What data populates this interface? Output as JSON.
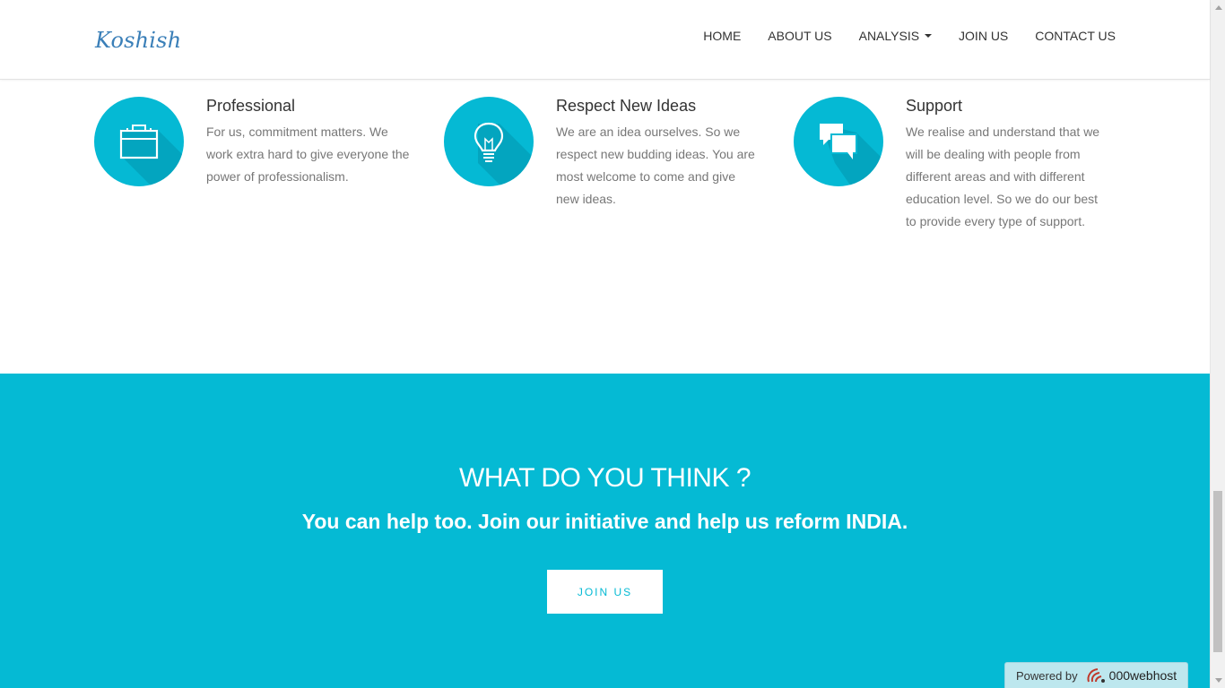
{
  "navbar": {
    "brand": "Koshish",
    "items": [
      {
        "label": "HOME"
      },
      {
        "label": "ABOUT US"
      },
      {
        "label": "ANALYSIS"
      },
      {
        "label": "JOIN US"
      },
      {
        "label": "CONTACT US"
      }
    ]
  },
  "features": [
    {
      "icon": "briefcase-icon",
      "title": "Professional",
      "text": "For us, commitment matters. We work extra hard to give everyone the power of professionalism."
    },
    {
      "icon": "lightbulb-icon",
      "title": "Respect New Ideas",
      "text": "We are an idea ourselves. So we respect new budding ideas. You are most welcome to come and give new ideas."
    },
    {
      "icon": "chat-bubbles-icon",
      "title": "Support",
      "text": "We realise and understand that we will be dealing with people from different areas and with different education level. So we do our best to provide every type of support."
    }
  ],
  "cta": {
    "heading": "WHAT DO YOU THINK ?",
    "subheading": "You can help too. Join our initiative and help us reform INDIA.",
    "button": "JOIN US"
  },
  "powered": {
    "prefix": "Powered by",
    "brand": "000webhost"
  },
  "colors": {
    "accent": "#05bad4",
    "brand": "#3a7fb8"
  }
}
